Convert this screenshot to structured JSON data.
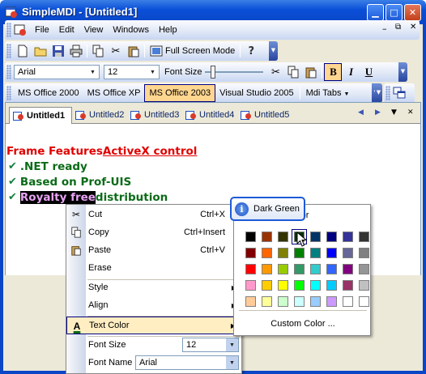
{
  "window": {
    "title": "SimpleMDI - [Untitled1]"
  },
  "menubar": {
    "items": [
      "File",
      "Edit",
      "View",
      "Windows",
      "Help"
    ]
  },
  "standard_toolbar": {
    "full_screen_label": "Full Screen Mode"
  },
  "format_toolbar": {
    "font_name": "Arial",
    "font_size": "12",
    "font_size_label": "Font Size",
    "bold": "B",
    "italic": "I",
    "underline": "U"
  },
  "style_toolbar": {
    "items": [
      "MS Office 2000",
      "MS Office XP",
      "MS Office 2003",
      "Visual Studio 2005",
      "Mdi Tabs"
    ],
    "active": "MS Office 2003"
  },
  "tabs": [
    "Untitled1",
    "Untitled2",
    "Untitled3",
    "Untitled4",
    "Untitled5"
  ],
  "document": {
    "heading_part1": "Frame Features ",
    "heading_link": "ActiveX control",
    "bullets": [
      ".NET ready",
      "Based on Prof-UIS"
    ],
    "bullet3_highlight": "Royalty free",
    "bullet3_rest": " distribution"
  },
  "context_menu": {
    "cut": "Cut",
    "cut_shortcut": "Ctrl+X",
    "copy": "Copy",
    "copy_shortcut": "Ctrl+Insert",
    "paste": "Paste",
    "paste_shortcut": "Ctrl+V",
    "erase": "Erase",
    "style": "Style",
    "align": "Align",
    "text_color": "Text Color",
    "font_size_label": "Font Size",
    "font_size_value": "12",
    "font_name_label": "Font Name",
    "font_name_value": "Arial"
  },
  "color_picker": {
    "header": "t Color",
    "custom_label": "Custom Color ...",
    "tooltip": "Dark Green",
    "colors": [
      [
        "#000000",
        "#993300",
        "#333300",
        "#003300",
        "#003366",
        "#000080",
        "#333399",
        "#333333"
      ],
      [
        "#800000",
        "#FF6600",
        "#808000",
        "#008000",
        "#008080",
        "#0000FF",
        "#666699",
        "#808080"
      ],
      [
        "#FF0000",
        "#FF9900",
        "#99CC00",
        "#339966",
        "#33CCCC",
        "#3366FF",
        "#800080",
        "#969696"
      ],
      [
        "#FF99CC",
        "#FFCC00",
        "#FFFF00",
        "#00FF00",
        "#00FFFF",
        "#00CCFF",
        "#993366",
        "#C0C0C0"
      ],
      [
        "#FFCC99",
        "#FFFF99",
        "#CCFFCC",
        "#CCFFFF",
        "#99CCFF",
        "#CC99FF",
        "#FFFFFF",
        "#FFFFFF"
      ]
    ]
  }
}
